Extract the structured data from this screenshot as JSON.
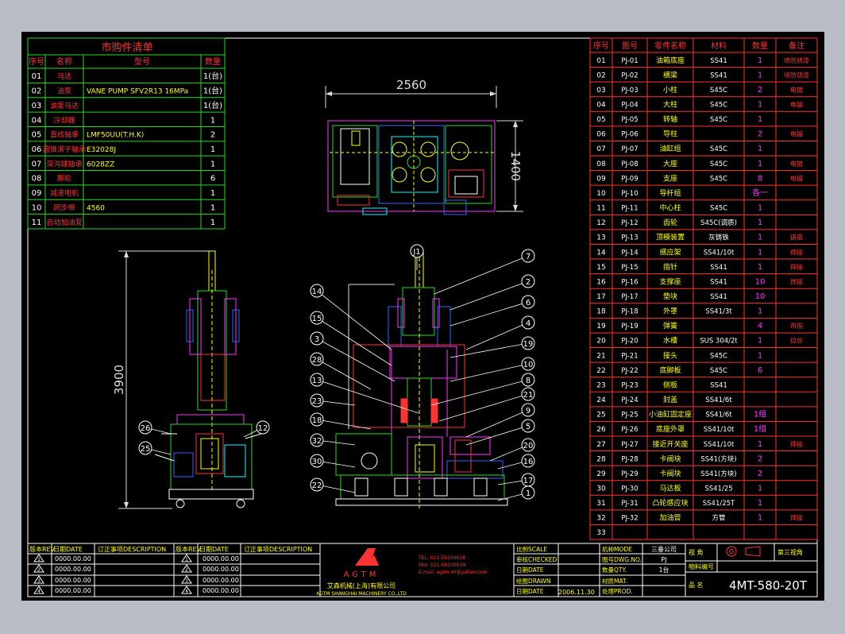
{
  "purchase_list": {
    "title": "市购件清单",
    "headers": [
      "序号",
      "名称",
      "型号",
      "数量"
    ],
    "rows": [
      {
        "no": "01",
        "name": "马达",
        "model": "",
        "qty": "1(台)"
      },
      {
        "no": "02",
        "name": "油泵",
        "model": "VANE PUMP SFV2R13 16MPa",
        "qty": "1(台)"
      },
      {
        "no": "03",
        "name": "油泵马达",
        "model": "",
        "qty": "1(台)"
      },
      {
        "no": "04",
        "name": "冷却器",
        "model": "",
        "qty": "1"
      },
      {
        "no": "05",
        "name": "直线轴承",
        "model": "LMF50UU(T.H.K)",
        "qty": "2"
      },
      {
        "no": "06",
        "name": "圆锥滚子轴承",
        "model": "E32028J",
        "qty": "1"
      },
      {
        "no": "07",
        "name": "深沟球轴承",
        "model": "6028ZZ",
        "qty": "1"
      },
      {
        "no": "08",
        "name": "脚轮",
        "model": "",
        "qty": "6"
      },
      {
        "no": "09",
        "name": "减速电机",
        "model": "",
        "qty": "1"
      },
      {
        "no": "10",
        "name": "同步带",
        "model": "4560",
        "qty": "1"
      },
      {
        "no": "11",
        "name": "自动加油泵",
        "model": "",
        "qty": "1"
      }
    ]
  },
  "parts_list": {
    "headers": [
      "序号",
      "图号",
      "零件名称",
      "材料",
      "数量",
      "备注"
    ],
    "rows": [
      {
        "no": "01",
        "code": "PJ-01",
        "name": "油箱底座",
        "mat": "SS41",
        "qty": "1",
        "note": "喷防锈漆"
      },
      {
        "no": "02",
        "code": "PJ-02",
        "name": "横梁",
        "mat": "SS41",
        "qty": "1",
        "note": "喷防锈漆"
      },
      {
        "no": "03",
        "code": "PJ-03",
        "name": "小柱",
        "mat": "S45C",
        "qty": "2",
        "note": "电镀"
      },
      {
        "no": "04",
        "code": "PJ-04",
        "name": "大柱",
        "mat": "S45C",
        "qty": "1",
        "note": "电镀"
      },
      {
        "no": "05",
        "code": "PJ-05",
        "name": "转轴",
        "mat": "S45C",
        "qty": "1",
        "note": ""
      },
      {
        "no": "06",
        "code": "PJ-06",
        "name": "导柱",
        "mat": "",
        "qty": "2",
        "note": "电镀"
      },
      {
        "no": "07",
        "code": "PJ-07",
        "name": "油缸组",
        "mat": "S45C",
        "qty": "1",
        "note": ""
      },
      {
        "no": "08",
        "code": "PJ-08",
        "name": "大座",
        "mat": "S45C",
        "qty": "1",
        "note": "电镀"
      },
      {
        "no": "09",
        "code": "PJ-09",
        "name": "支座",
        "mat": "S45C",
        "qty": "8",
        "note": "电镀"
      },
      {
        "no": "10",
        "code": "PJ-10",
        "name": "导杆组",
        "mat": "",
        "qty": "各一",
        "note": ""
      },
      {
        "no": "11",
        "code": "PJ-11",
        "name": "中心柱",
        "mat": "S45C",
        "qty": "1",
        "note": ""
      },
      {
        "no": "12",
        "code": "PJ-12",
        "name": "齿轮",
        "mat": "S45C(调质)",
        "qty": "1",
        "note": ""
      },
      {
        "no": "13",
        "code": "PJ-13",
        "name": "顶模装置",
        "mat": "灰铸铁",
        "qty": "1",
        "note": "铸造"
      },
      {
        "no": "14",
        "code": "PJ-14",
        "name": "感应架",
        "mat": "SS41/10t",
        "qty": "1",
        "note": "焊接"
      },
      {
        "no": "15",
        "code": "PJ-15",
        "name": "指针",
        "mat": "SS41",
        "qty": "1",
        "note": "焊接"
      },
      {
        "no": "16",
        "code": "PJ-16",
        "name": "支撑座",
        "mat": "SS41",
        "qty": "10",
        "note": "焊接"
      },
      {
        "no": "17",
        "code": "PJ-17",
        "name": "垫块",
        "mat": "SS41",
        "qty": "10",
        "note": ""
      },
      {
        "no": "18",
        "code": "PJ-18",
        "name": "外罩",
        "mat": "SS41/3t",
        "qty": "1",
        "note": ""
      },
      {
        "no": "19",
        "code": "PJ-19",
        "name": "弹簧",
        "mat": "",
        "qty": "4",
        "note": "市购"
      },
      {
        "no": "20",
        "code": "PJ-20",
        "name": "水槽",
        "mat": "SUS 304/2t",
        "qty": "1",
        "note": "拉丝"
      },
      {
        "no": "21",
        "code": "PJ-21",
        "name": "接头",
        "mat": "S45C",
        "qty": "1",
        "note": ""
      },
      {
        "no": "22",
        "code": "PJ-22",
        "name": "底脚板",
        "mat": "S45C",
        "qty": "6",
        "note": ""
      },
      {
        "no": "23",
        "code": "PJ-23",
        "name": "侧板",
        "mat": "SS41",
        "qty": "",
        "note": ""
      },
      {
        "no": "24",
        "code": "PJ-24",
        "name": "封盖",
        "mat": "SS41/6t",
        "qty": "",
        "note": ""
      },
      {
        "no": "25",
        "code": "PJ-25",
        "name": "小油缸固定座",
        "mat": "SS41/6t",
        "qty": "1组",
        "note": ""
      },
      {
        "no": "26",
        "code": "PJ-26",
        "name": "底座外罩",
        "mat": "SS41/10t",
        "qty": "1组",
        "note": ""
      },
      {
        "no": "27",
        "code": "PJ-27",
        "name": "接近开关座",
        "mat": "SS41/10t",
        "qty": "1",
        "note": "焊接"
      },
      {
        "no": "28",
        "code": "PJ-28",
        "name": "卡阀块",
        "mat": "SS41(方块)",
        "qty": "2",
        "note": ""
      },
      {
        "no": "29",
        "code": "PJ-29",
        "name": "卡阀块",
        "mat": "SS41(方块)",
        "qty": "2",
        "note": ""
      },
      {
        "no": "30",
        "code": "PJ-30",
        "name": "马达板",
        "mat": "SS41/25",
        "qty": "1",
        "note": ""
      },
      {
        "no": "31",
        "code": "PJ-31",
        "name": "凸轮感应块",
        "mat": "SS41/25T",
        "qty": "1",
        "note": ""
      },
      {
        "no": "32",
        "code": "PJ-32",
        "name": "加油管",
        "mat": "方管",
        "qty": "1",
        "note": "焊接"
      },
      {
        "no": "33",
        "code": "",
        "name": "",
        "mat": "",
        "qty": "",
        "note": ""
      }
    ]
  },
  "dimensions": {
    "top_width": "2560",
    "top_depth": "1400",
    "side_height": "3900"
  },
  "balloons_front": [
    "J1",
    "7",
    "2",
    "6",
    "4",
    "19",
    "10",
    "8",
    "21",
    "9",
    "5",
    "20",
    "16",
    "17",
    "1",
    "14",
    "15",
    "3",
    "28",
    "13",
    "23",
    "18",
    "32",
    "30",
    "22"
  ],
  "balloons_side": [
    "26",
    "25",
    "12"
  ],
  "revision_block": {
    "col_headers": [
      "版本REV.",
      "日期DATE",
      "订正事项DESCRIPTION"
    ],
    "rows": [
      "0000.00.00",
      "0000.00.00",
      "0000.00.00",
      "0000.00.00"
    ],
    "marks": [
      "1",
      "2",
      "3",
      "4"
    ]
  },
  "company": {
    "logo_text": "AGTM",
    "name_cn": "艾森机械(上海)有限公司",
    "name_en": "AGTM SHANGHAI MACHINERY CO.,LTD",
    "tel": "TEL: 021-59100638",
    "fax": "FAX: 021-59100639",
    "email": "E-mail: agtm-sh@yahoo.com"
  },
  "title_block": {
    "labels": [
      "比例SCALE",
      "审核CHECKED",
      "日期DATE",
      "绘图DRAWN",
      "日期DATE"
    ],
    "date_value": "2006.11.30",
    "labels2": [
      "机种MODE",
      "图号DWG.NO.",
      "数量QTY.",
      "材质MAT.",
      "处理PROD."
    ],
    "values2": [
      "三垂公司",
      "PJ",
      "1台",
      "",
      ""
    ],
    "view_label": "视 角",
    "projection": "第三视角",
    "customer_label": "物料编号",
    "drawing_name_label": "品 名",
    "drawing_no": "4MT-580-20T"
  }
}
